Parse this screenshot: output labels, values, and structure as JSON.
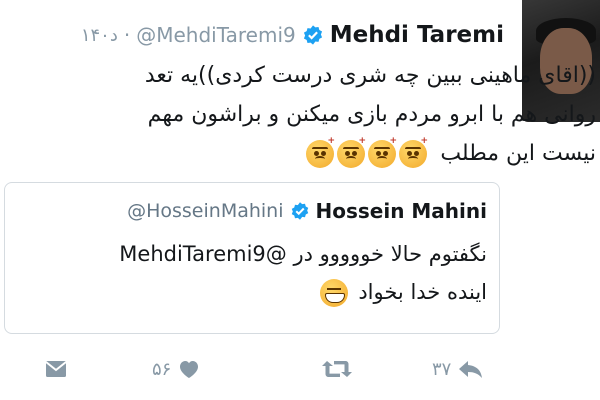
{
  "tweet": {
    "author_name": "Mehdi Taremi",
    "handle": "@MehdiTaremi9",
    "separator": "·",
    "time": "۱۴۰د",
    "lines": [
      "((اقای ماهینی ببین چه شری درست کردی))یه تعد",
      "روانی هم با ابرو مردم بازی میکنن و براشون مهم",
      "نیست این مطلب"
    ]
  },
  "quoted": {
    "author_name": "Hossein Mahini",
    "handle": "@HosseinMahini",
    "line1_mention": "@MehdiTaremi9",
    "line1_text": "نگفتوم حالا خووووو در",
    "line2": "اینده خدا بخواد"
  },
  "actions": {
    "reply_count": "۳۷",
    "like_count": "۵۶"
  },
  "colors": {
    "verified": "#1da1f2",
    "muted": "#8899a6",
    "border": "#d5dbe0"
  },
  "icons": [
    "verified-badge-icon",
    "reply-icon",
    "retweet-icon",
    "like-icon",
    "direct-message-icon",
    "angry-emoji-icon",
    "grin-emoji-icon"
  ]
}
